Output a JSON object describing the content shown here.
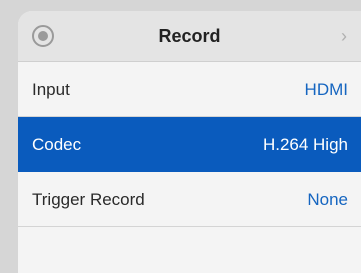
{
  "header": {
    "title": "Record",
    "record_icon": "record-circle-icon",
    "chevron_icon": "chevron-right-icon",
    "chevron_glyph": "›"
  },
  "settings": [
    {
      "label": "Input",
      "value": "HDMI",
      "selected": false
    },
    {
      "label": "Codec",
      "value": "H.264 High",
      "selected": true
    },
    {
      "label": "Trigger Record",
      "value": "None",
      "selected": false
    }
  ],
  "colors": {
    "accent": "#0a5bbd",
    "value_text": "#1565c0",
    "background": "#ececec"
  }
}
